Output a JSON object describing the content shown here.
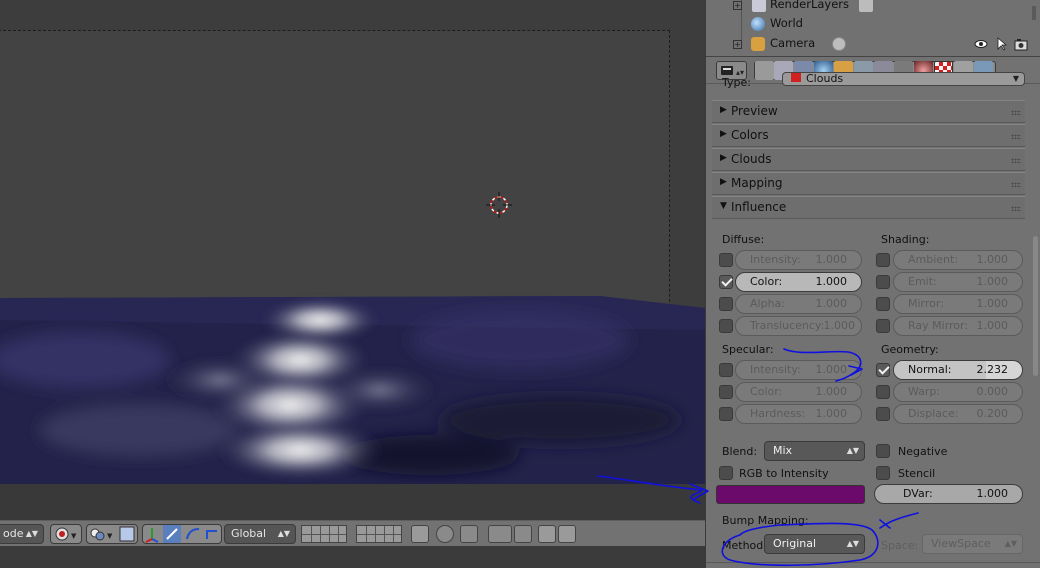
{
  "outliner": {
    "rows": [
      {
        "label": "RenderLayers"
      },
      {
        "label": "World"
      },
      {
        "label": "Camera"
      }
    ]
  },
  "properties": {
    "type_label": "Type:",
    "type_value": "Clouds",
    "panels": {
      "preview": "Preview",
      "colors": "Colors",
      "clouds": "Clouds",
      "mapping": "Mapping",
      "influence": "Influence"
    },
    "diffuse": {
      "title": "Diffuse:",
      "intensity": {
        "label": "Intensity:",
        "value": "1.000",
        "checked": false
      },
      "color": {
        "label": "Color:",
        "value": "1.000",
        "checked": true
      },
      "alpha": {
        "label": "Alpha:",
        "value": "1.000",
        "checked": false
      },
      "translucency": {
        "label": "Translucency:",
        "value": "1.000",
        "checked": false
      }
    },
    "shading": {
      "title": "Shading:",
      "ambient": {
        "label": "Ambient:",
        "value": "1.000",
        "checked": false
      },
      "emit": {
        "label": "Emit:",
        "value": "1.000",
        "checked": false
      },
      "mirror": {
        "label": "Mirror:",
        "value": "1.000",
        "checked": false
      },
      "ray_mirror": {
        "label": "Ray Mirror:",
        "value": "1.000",
        "checked": false
      }
    },
    "specular": {
      "title": "Specular:",
      "intensity": {
        "label": "Intensity:",
        "value": "1.000",
        "checked": false
      },
      "color": {
        "label": "Color:",
        "value": "1.000",
        "checked": false
      },
      "hardness": {
        "label": "Hardness:",
        "value": "1.000",
        "checked": false
      }
    },
    "geometry": {
      "title": "Geometry:",
      "normal": {
        "label": "Normal:",
        "value": "2.232",
        "checked": true
      },
      "warp": {
        "label": "Warp:",
        "value": "0.000",
        "checked": false
      },
      "displace": {
        "label": "Displace:",
        "value": "0.200",
        "checked": false
      }
    },
    "blend": {
      "label": "Blend:",
      "value": "Mix"
    },
    "negative": "Negative",
    "rgb_to_intensity": "RGB to Intensity",
    "stencil": "Stencil",
    "color_swatch": "#6b0a6b",
    "dvar": {
      "label": "DVar:",
      "value": "1.000"
    },
    "bump_mapping": {
      "title": "Bump Mapping:",
      "method_label": "Method:",
      "method_value": "Original",
      "space_label": "Space:",
      "space_value": "ViewSpace"
    }
  },
  "viewport_header": {
    "mode": "ode",
    "orientation": "Global"
  },
  "colors": {
    "annotation": "#1010e0",
    "water": "#23224a"
  }
}
